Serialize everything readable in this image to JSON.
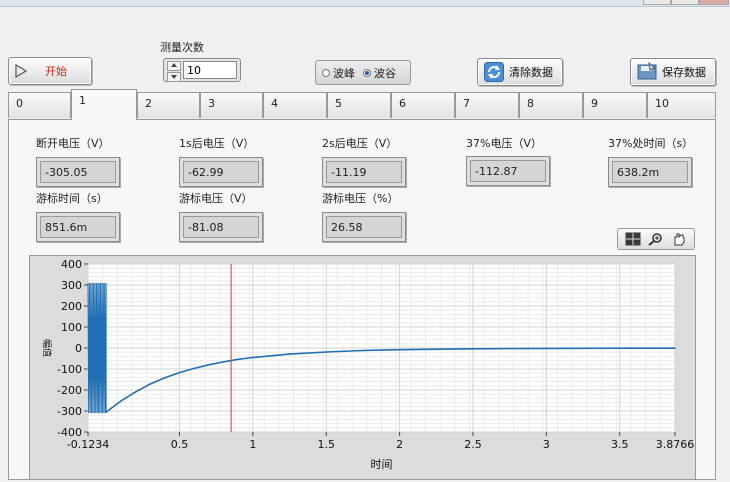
{
  "toolbar": {
    "start_label": "开始",
    "count_label": "测量次数",
    "count_value": "10",
    "mode_options": [
      {
        "label": "波峰",
        "selected": false
      },
      {
        "label": "波谷",
        "selected": true
      }
    ],
    "clear_label": "清除数据",
    "save_label": "保存数据"
  },
  "tabs": [
    {
      "label": "0",
      "active": false
    },
    {
      "label": "1",
      "active": true
    },
    {
      "label": "2",
      "active": false
    },
    {
      "label": "3",
      "active": false
    },
    {
      "label": "4",
      "active": false
    },
    {
      "label": "5",
      "active": false
    },
    {
      "label": "6",
      "active": false
    },
    {
      "label": "7",
      "active": false
    },
    {
      "label": "8",
      "active": false
    },
    {
      "label": "9",
      "active": false
    },
    {
      "label": "10",
      "active": false
    }
  ],
  "indicators": {
    "off_voltage": {
      "label": "断开电压（V）",
      "value": "-305.05"
    },
    "v_1s": {
      "label": "1s后电压（V）",
      "value": "-62.99"
    },
    "v_2s": {
      "label": "2s后电压（V）",
      "value": "-11.19"
    },
    "v_37": {
      "label": "37%电压（V）",
      "value": "-112.87"
    },
    "t_37": {
      "label": "37%处时间（s）",
      "value": "638.2m"
    },
    "cursor_time": {
      "label": "游标时间（s）",
      "value": "851.6m"
    },
    "cursor_voltage": {
      "label": "游标电压（V）",
      "value": "-81.08"
    },
    "cursor_percent": {
      "label": "游标电压（%）",
      "value": "26.58"
    }
  },
  "palette_icons": [
    "cursor-tool-icon",
    "zoom-icon",
    "pan-hand-icon"
  ],
  "chart_data": {
    "type": "line",
    "xlabel": "时间",
    "ylabel": "幅值",
    "xlim": [
      -0.1234,
      3.8766
    ],
    "ylim": [
      -400,
      400
    ],
    "x_ticks": [
      "-0.1234",
      "0.5",
      "1",
      "1.5",
      "2",
      "2.5",
      "3",
      "3.5",
      "3.8766"
    ],
    "x_tick_values": [
      -0.1234,
      0.5,
      1,
      1.5,
      2,
      2.5,
      3,
      3.5,
      3.8766
    ],
    "y_ticks": [
      400,
      300,
      200,
      100,
      0,
      -100,
      -200,
      -300,
      -400
    ],
    "grid": true,
    "cursor_x": 0.8516,
    "oscillation": {
      "x_start": -0.1234,
      "x_end": 0.0,
      "high": 310,
      "low": -310
    },
    "x": [
      0.0,
      0.1,
      0.2,
      0.3,
      0.4,
      0.5,
      0.6,
      0.7,
      0.8,
      0.9,
      1.0,
      1.25,
      1.5,
      1.75,
      2.0,
      2.5,
      3.0,
      3.5,
      3.8766
    ],
    "series": [
      {
        "values": [
          -305,
          -253,
          -209,
          -172,
          -142,
          -117,
          -97,
          -80,
          -66,
          -54,
          -45,
          -29,
          -19,
          -12,
          -8,
          -4,
          -2,
          -1,
          -1
        ],
        "color": "#1f6fb4"
      }
    ],
    "cursor_color": "#e03030"
  }
}
